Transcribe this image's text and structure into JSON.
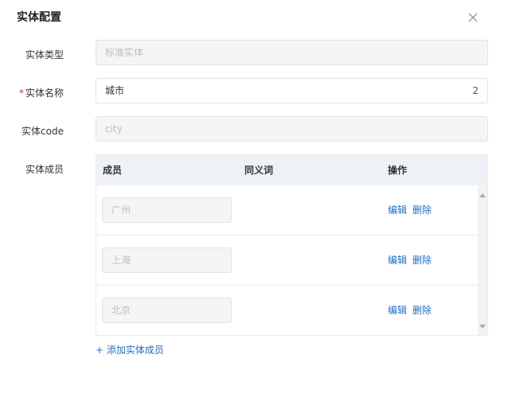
{
  "dialog": {
    "title": "实体配置",
    "close_icon": "close-icon"
  },
  "form": {
    "type": {
      "label": "实体类型",
      "placeholder": "标准实体"
    },
    "name": {
      "required_mark": "*",
      "label": "实体名称",
      "value": "城市",
      "count": "2"
    },
    "code": {
      "label": "实体code",
      "placeholder": "city"
    },
    "members": {
      "label": "实体成员"
    }
  },
  "table": {
    "headers": [
      "成员",
      "同义词",
      "操作"
    ],
    "rows": [
      {
        "member_placeholder": "广州",
        "edit": "编辑",
        "delete": "删除"
      },
      {
        "member_placeholder": "上海",
        "edit": "编辑",
        "delete": "删除"
      },
      {
        "member_placeholder": "北京",
        "edit": "编辑",
        "delete": "删除"
      }
    ]
  },
  "add_member_label": "+ 添加实体成员",
  "colors": {
    "link": "#1f6fbf",
    "required": "#d93026",
    "header_bg": "#eef2f7"
  }
}
